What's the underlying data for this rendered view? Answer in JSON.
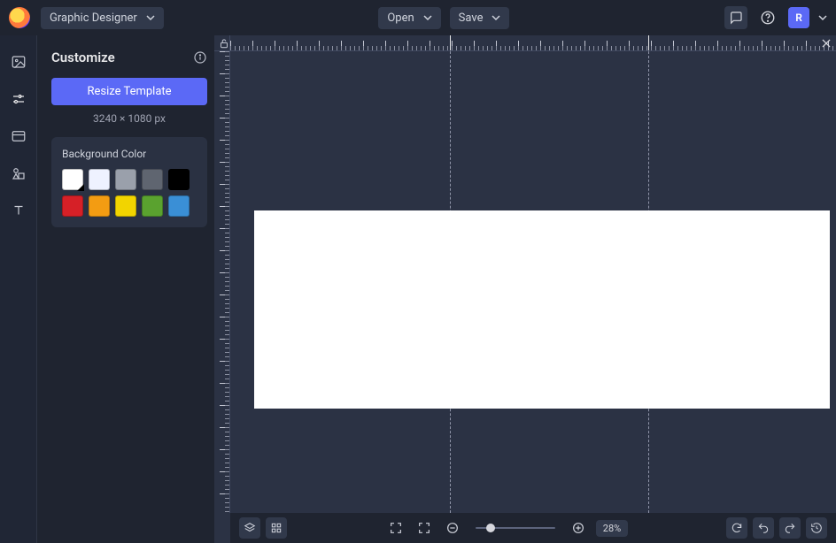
{
  "header": {
    "app_name": "Graphic Designer",
    "open_label": "Open",
    "save_label": "Save",
    "avatar_initial": "R"
  },
  "rail": {
    "items": [
      "image",
      "adjust",
      "frame",
      "shapes",
      "text"
    ]
  },
  "panel": {
    "title": "Customize",
    "resize_label": "Resize Template",
    "dimensions": "3240 × 1080 px",
    "bg_label": "Background Color",
    "swatches": {
      "row1": [
        "#ffffff",
        "#eef2ff",
        "#9aa0ab",
        "#5f6570",
        "#000000"
      ],
      "row2": [
        "#d62027",
        "#f39c12",
        "#f2d400",
        "#5aa22f",
        "#3a8fd6"
      ]
    },
    "selected_swatch": 0
  },
  "canvas": {
    "zoom_pct": "28%"
  }
}
